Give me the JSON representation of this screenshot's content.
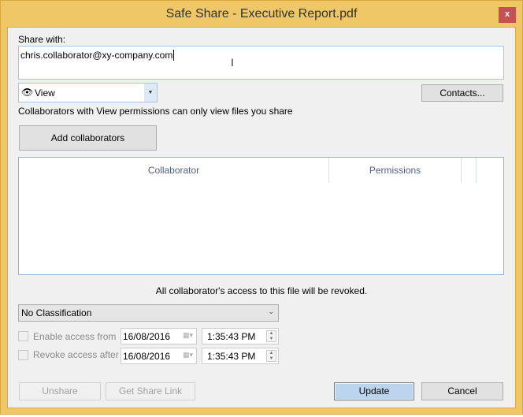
{
  "window": {
    "title": "Safe Share - Executive Report.pdf",
    "close_label": "x"
  },
  "share": {
    "label": "Share with:",
    "value": "chris.collaborator@xy-company.com"
  },
  "permission": {
    "selected": "View",
    "help": "Collaborators with View permissions can only view files you share"
  },
  "buttons": {
    "contacts": "Contacts...",
    "add": "Add collaborators",
    "unshare": "Unshare",
    "link": "Get Share Link",
    "update": "Update",
    "cancel": "Cancel"
  },
  "table": {
    "columns": [
      "Collaborator",
      "Permissions"
    ]
  },
  "notice": "All collaborator's access to this file will be revoked.",
  "classification": {
    "selected": "No Classification"
  },
  "access": [
    {
      "label": "Enable access from",
      "date": "16/08/2016",
      "time": "1:35:43 PM"
    },
    {
      "label": "Revoke access after",
      "date": "16/08/2016",
      "time": "1:35:43 PM"
    }
  ]
}
